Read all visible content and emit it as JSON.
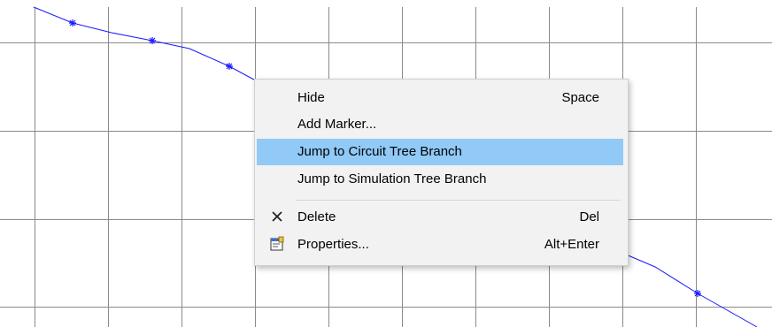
{
  "context_menu": {
    "items": [
      {
        "label": "Hide",
        "shortcut": "Space",
        "icon": null
      },
      {
        "label": "Add Marker...",
        "shortcut": "",
        "icon": null
      },
      {
        "label": "Jump to Circuit Tree Branch",
        "shortcut": "",
        "icon": null,
        "highlighted": true
      },
      {
        "label": "Jump to Simulation Tree Branch",
        "shortcut": "",
        "icon": null
      },
      {
        "label": "Delete",
        "shortcut": "Del",
        "icon": "delete-x-icon"
      },
      {
        "label": "Properties...",
        "shortcut": "Alt+Enter",
        "icon": "properties-icon"
      }
    ]
  },
  "plot": {
    "grid_color": "#8a8a8a",
    "trace_color": "#1a1aff",
    "marker": "asterisk"
  },
  "colors": {
    "menu_background": "#f2f2f2",
    "highlight": "#91c9f7"
  }
}
